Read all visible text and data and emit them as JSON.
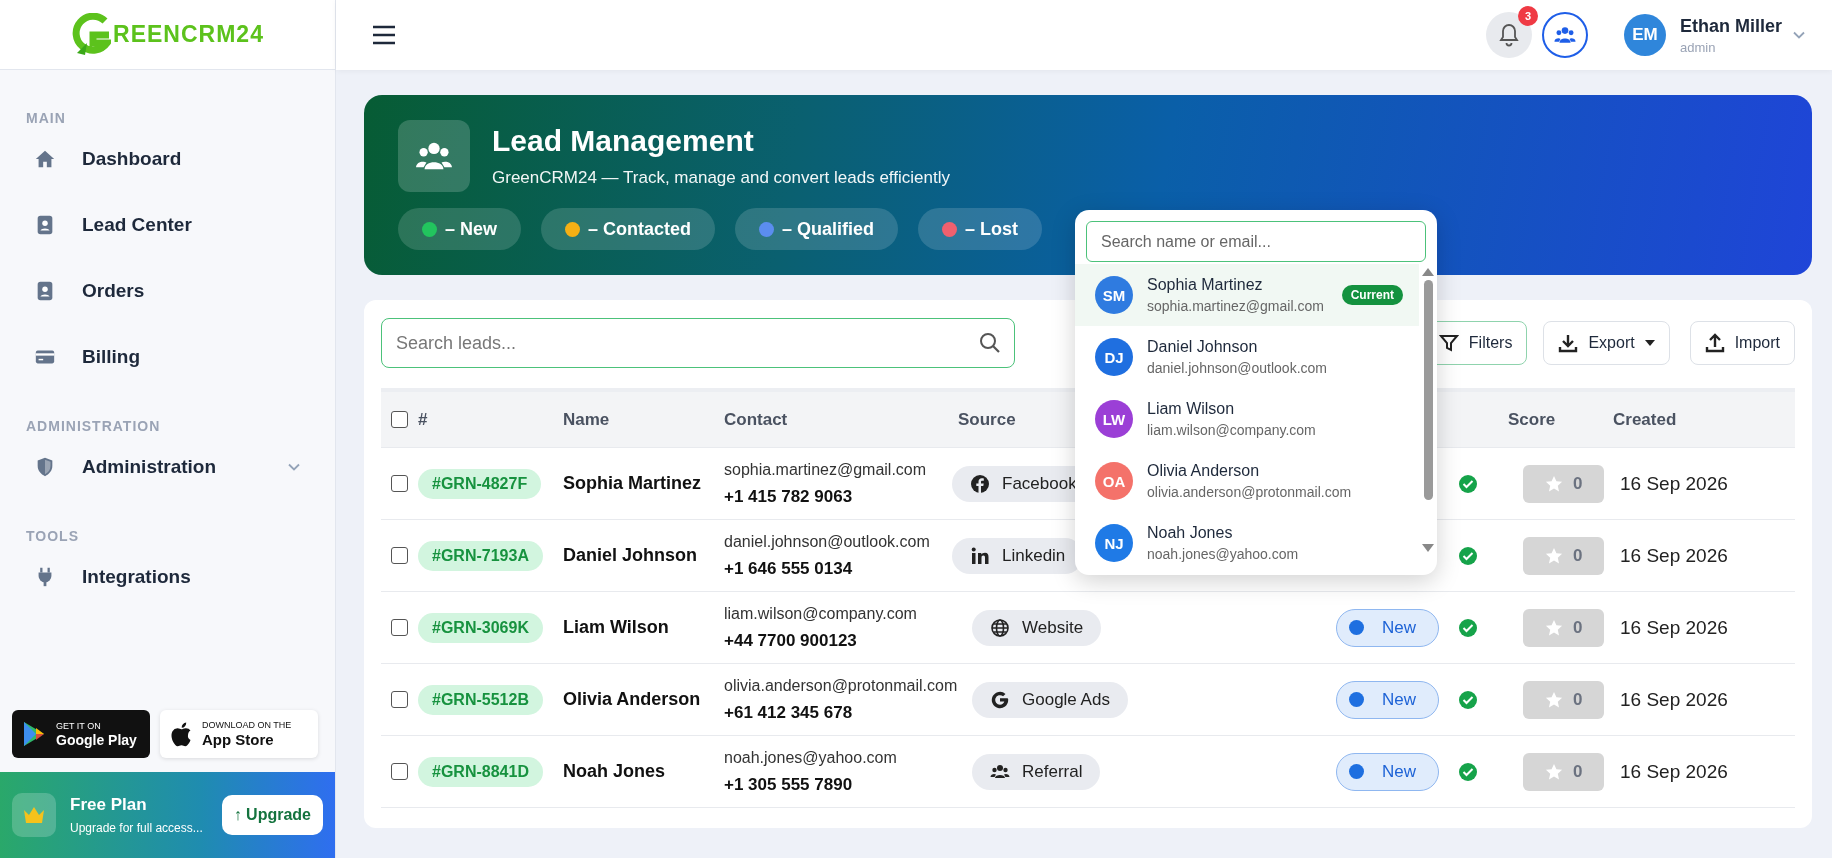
{
  "sidebar": {
    "logo_text": "REENCRM24",
    "sections": [
      {
        "heading": "MAIN",
        "items": [
          {
            "label": "Dashboard",
            "expandable": false
          },
          {
            "label": "Lead Center",
            "expandable": false
          },
          {
            "label": "Orders",
            "expandable": false
          },
          {
            "label": "Billing",
            "expandable": false
          }
        ]
      },
      {
        "heading": "ADMINISTRATION",
        "items": [
          {
            "label": "Administration",
            "expandable": true
          }
        ]
      },
      {
        "heading": "TOOLS",
        "items": [
          {
            "label": "Integrations",
            "expandable": false
          }
        ]
      }
    ],
    "store_badges": [
      {
        "kind": "google",
        "small": "GET IT ON",
        "big": "Google Play"
      },
      {
        "kind": "apple",
        "small": "DOWNLOAD ON THE",
        "big": "App Store"
      }
    ],
    "plan": {
      "title": "Free Plan",
      "subtitle": "Upgrade for full access...",
      "button": "↑ Upgrade"
    }
  },
  "topbar": {
    "notifications": "3",
    "user": {
      "initials": "EM",
      "name": "Ethan Miller",
      "role": "admin"
    }
  },
  "banner": {
    "title": "Lead Management",
    "subtitle": "GreenCRM24 — Track, manage and convert leads efficiently",
    "legend": [
      {
        "label": "– New",
        "color": "#22c55e"
      },
      {
        "label": "– Contacted",
        "color": "#f5b014"
      },
      {
        "label": "– Qualified",
        "color": "#5b8def"
      },
      {
        "label": "– Lost",
        "color": "#f0606e"
      }
    ]
  },
  "toolbar": {
    "search_placeholder": "Search leads...",
    "buttons": [
      {
        "label": "Filters",
        "kind": "filter"
      },
      {
        "label": "Export",
        "kind": "export"
      },
      {
        "label": "Import",
        "kind": "import"
      }
    ]
  },
  "table": {
    "select_all": false,
    "columns": [
      {
        "label": "#",
        "kind": "id"
      },
      {
        "label": "Name",
        "kind": "name"
      },
      {
        "label": "Contact",
        "kind": "contact"
      },
      {
        "label": "Source",
        "kind": "source"
      },
      {
        "label": "Score",
        "kind": "score"
      },
      {
        "label": "Created",
        "kind": "created"
      }
    ],
    "rows": [
      {
        "checked": false,
        "id": "#GRN-4827F",
        "name": "Sophia Martinez",
        "email": "sophia.martinez@gmail.com",
        "phone": "+1 415 782 9063",
        "source": {
          "label": "Facebook",
          "kind": "facebook"
        },
        "verified": true,
        "score": "0",
        "created": "16 Sep 2026"
      },
      {
        "checked": false,
        "id": "#GRN-7193A",
        "name": "Daniel Johnson",
        "email": "daniel.johnson@outlook.com",
        "phone": "+1 646 555 0134",
        "source": {
          "label": "Linkedin",
          "kind": "linkedin"
        },
        "verified": true,
        "score": "0",
        "created": "16 Sep 2026"
      },
      {
        "checked": false,
        "id": "#GRN-3069K",
        "name": "Liam Wilson",
        "email": "liam.wilson@company.com",
        "phone": "+44 7700 900123",
        "source": {
          "label": "Website",
          "kind": "website"
        },
        "status": "New",
        "verified": true,
        "score": "0",
        "created": "16 Sep 2026"
      },
      {
        "checked": false,
        "id": "#GRN-5512B",
        "name": "Olivia Anderson",
        "email": "olivia.anderson@protonmail.com",
        "phone": "+61 412 345 678",
        "source": {
          "label": "Google Ads",
          "kind": "google"
        },
        "status": "New",
        "verified": true,
        "score": "0",
        "created": "16 Sep 2026"
      },
      {
        "checked": false,
        "id": "#GRN-8841D",
        "name": "Noah Jones",
        "email": "noah.jones@yahoo.com",
        "phone": "+1 305 555 7890",
        "source": {
          "label": "Referral",
          "kind": "referral"
        },
        "status": "New",
        "verified": true,
        "score": "0",
        "created": "16 Sep 2026"
      }
    ]
  },
  "dropdown": {
    "placeholder": "Search name or email...",
    "items": [
      {
        "initials": "SM",
        "name": "Sophia Martinez",
        "email": "sophia.martinez@gmail.com",
        "color": "#2f7be0",
        "selected": true,
        "badge": "Current"
      },
      {
        "initials": "DJ",
        "name": "Daniel Johnson",
        "email": "daniel.johnson@outlook.com",
        "color": "#1f6fe0",
        "selected": false
      },
      {
        "initials": "LW",
        "name": "Liam Wilson",
        "email": "liam.wilson@company.com",
        "color": "#9b3fd6",
        "selected": false
      },
      {
        "initials": "OA",
        "name": "Olivia Anderson",
        "email": "olivia.anderson@protonmail.com",
        "color": "#f4726a",
        "selected": false
      },
      {
        "initials": "NJ",
        "name": "Noah Jones",
        "email": "noah.jones@yahoo.com",
        "color": "#1f7ae6",
        "selected": false
      }
    ]
  }
}
